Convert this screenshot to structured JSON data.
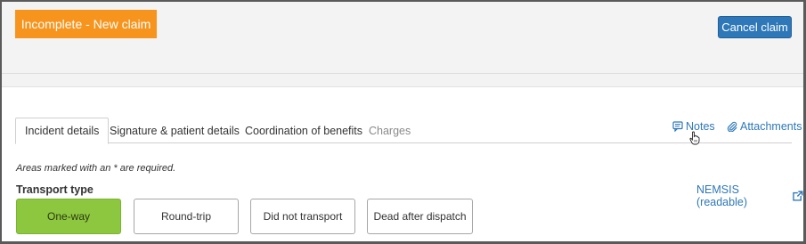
{
  "header": {
    "status_banner": "Incomplete - New claim",
    "cancel_label": "Cancel claim"
  },
  "tabs": [
    {
      "label": "Incident details",
      "state": "active"
    },
    {
      "label": "Signature & patient details",
      "state": "normal"
    },
    {
      "label": "Coordination of benefits",
      "state": "normal"
    },
    {
      "label": "Charges",
      "state": "disabled"
    }
  ],
  "tab_links": {
    "notes": {
      "label": "Notes",
      "icon": "comment-icon"
    },
    "attachments": {
      "label": "Attachments",
      "icon": "paperclip-icon"
    }
  },
  "form": {
    "required_note": "Areas marked with an * are required.",
    "transport_type_label": "Transport type",
    "nemsis_link": "NEMSIS (readable)",
    "nemsis_icon": "external-link-icon",
    "transport_options": [
      {
        "label": "One-way",
        "selected": true
      },
      {
        "label": "Round-trip",
        "selected": false
      },
      {
        "label": "Did not transport",
        "selected": false
      },
      {
        "label": "Dead after dispatch",
        "selected": false
      }
    ]
  },
  "colors": {
    "status_orange": "#f7941d",
    "primary_blue": "#2e78b9",
    "selected_green": "#8dc63f"
  }
}
